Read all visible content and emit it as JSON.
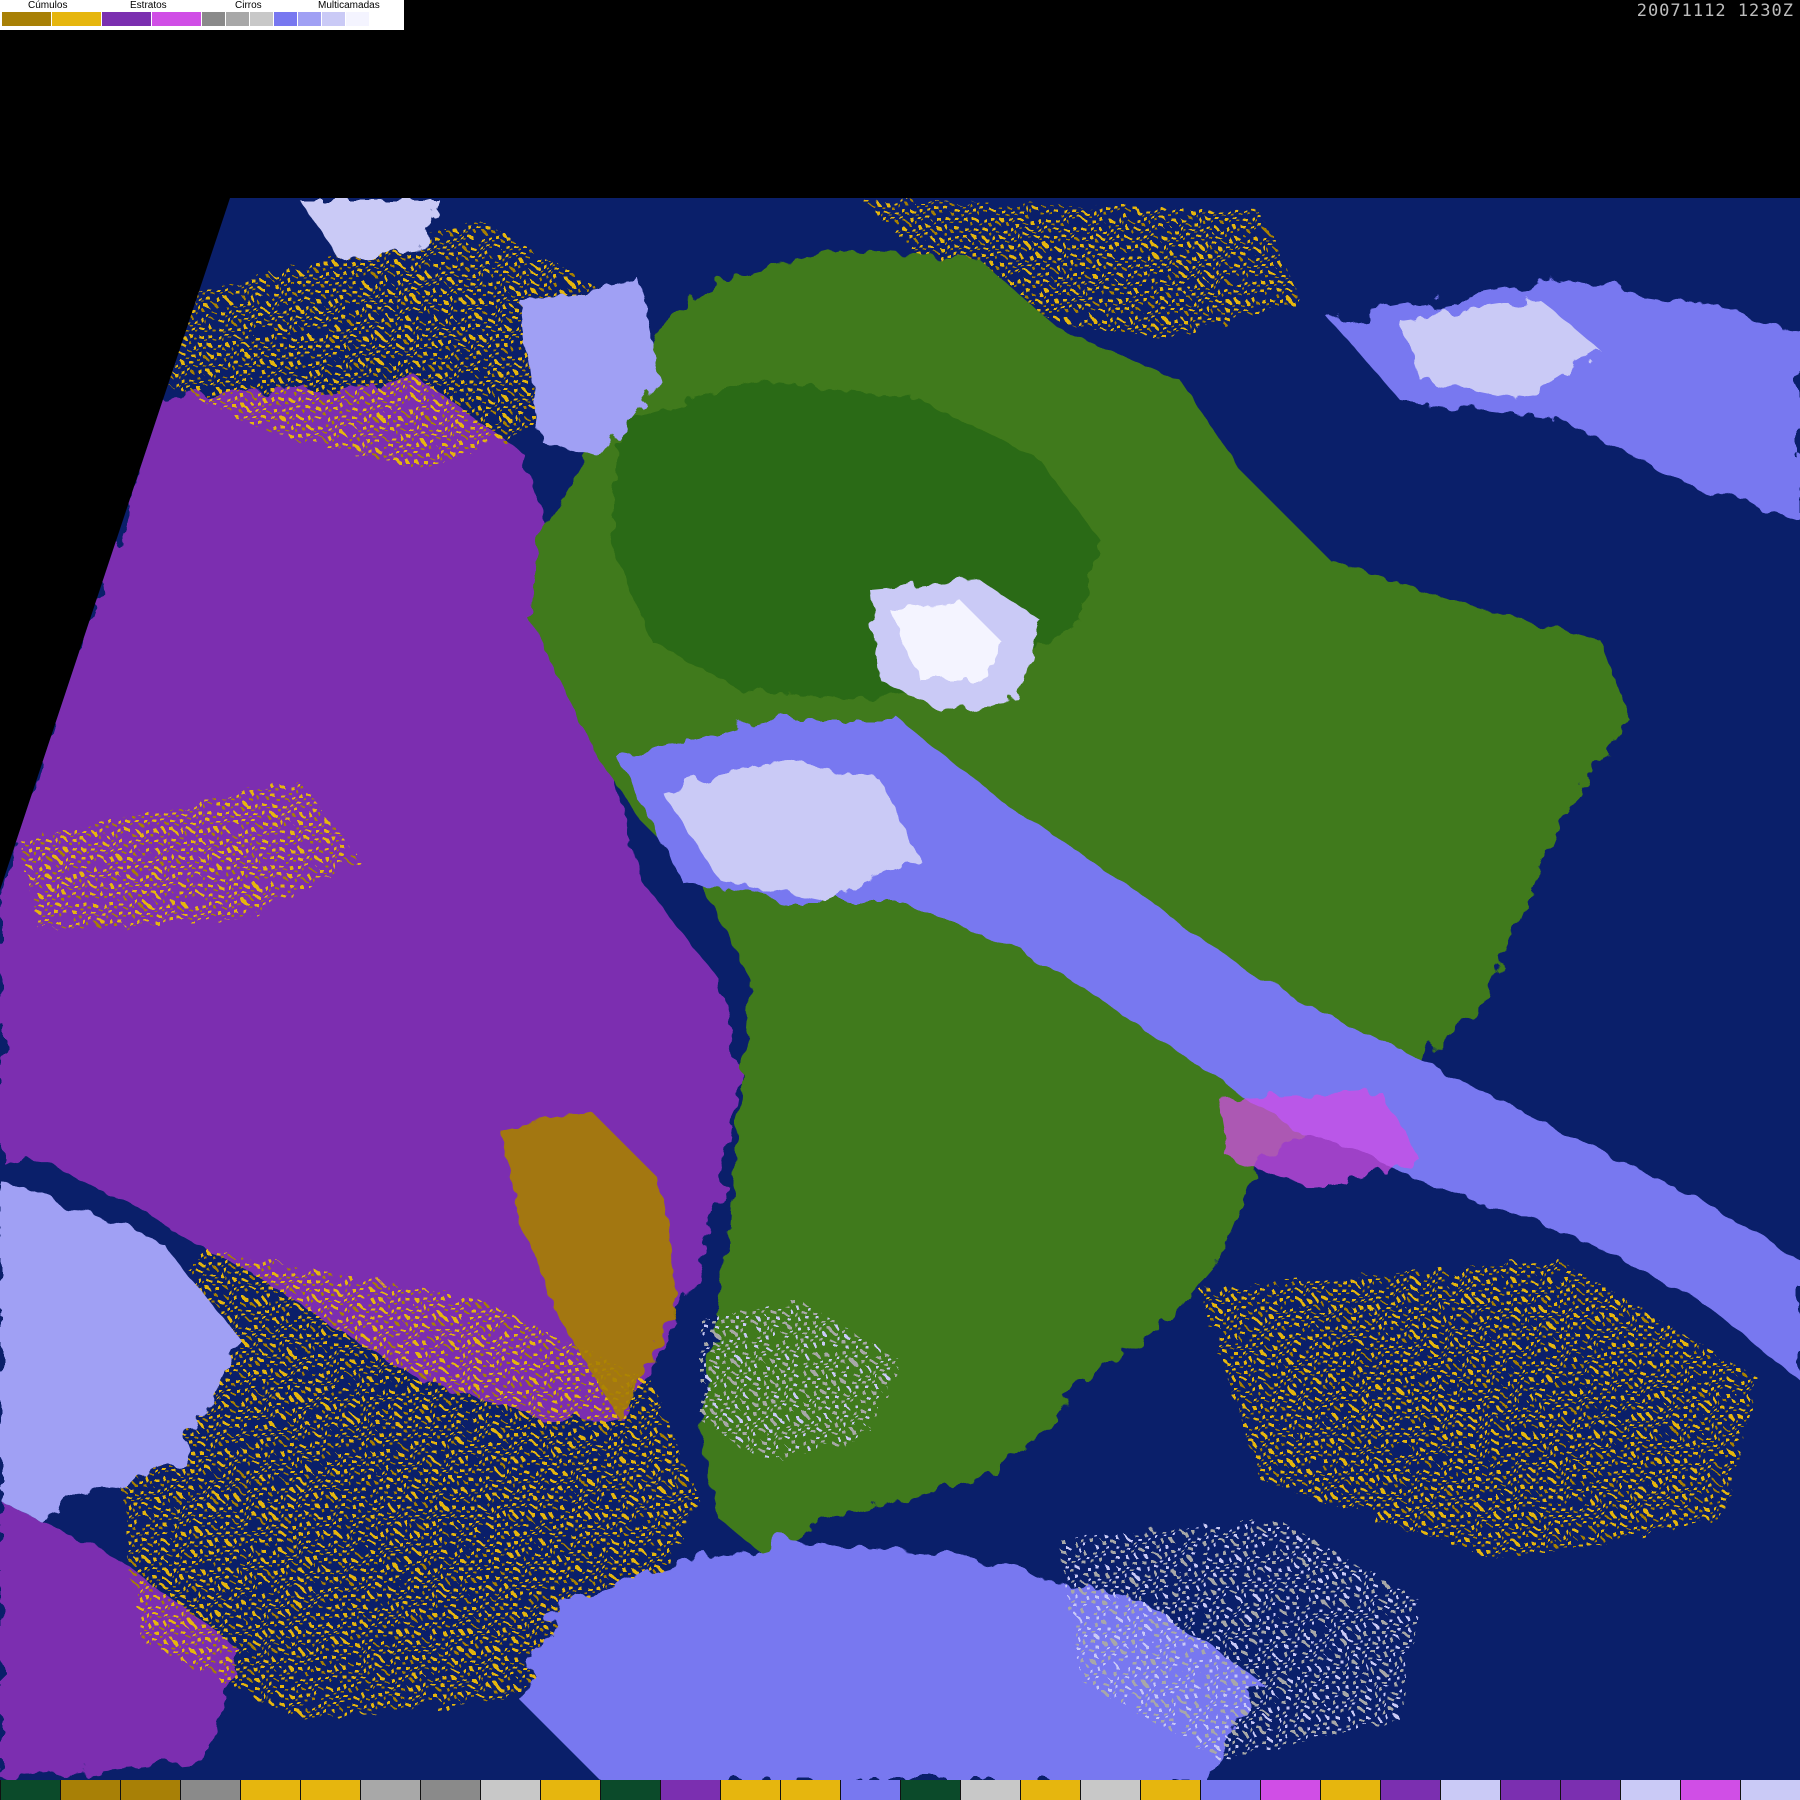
{
  "legend": {
    "groups": [
      {
        "label": "Cúmulos",
        "colors": [
          "#a88006",
          "#e6b60e"
        ]
      },
      {
        "label": "Estratos",
        "colors": [
          "#7b2fb0",
          "#d04ee6"
        ]
      },
      {
        "label": "Cirros",
        "colors": [
          "#8a8a8a",
          "#a8a8a8",
          "#c8c8c8"
        ]
      },
      {
        "label": "Multicamadas",
        "colors": [
          "#7878f0",
          "#a0a0f4",
          "#cacaf6",
          "#f4f4ff"
        ]
      }
    ]
  },
  "timestamp": "20071112 1230Z",
  "colors": {
    "background": "#000000",
    "ocean": "#0a1f6a",
    "land": "#3f7a1e",
    "forest": "#2a6a14",
    "cumulus_dark": "#a88006",
    "cumulus_light": "#e6b60e",
    "stratus": "#7b2fb0",
    "stratus_light": "#d04ee6",
    "cirrus": "#a8a8a8",
    "multilayer": "#7878f0",
    "multilayer_light": "#cacaf6"
  },
  "bottom_strip": [
    "#0b4a2a",
    "#a88006",
    "#a88006",
    "#8a8a8a",
    "#e6b60e",
    "#e6b60e",
    "#a8a8a8",
    "#8a8a8a",
    "#c8c8c8",
    "#e6b60e",
    "#0b4a2a",
    "#7b2fb0",
    "#e6b60e",
    "#e6b60e",
    "#7878f0",
    "#0b4a2a",
    "#c8c8c8",
    "#e6b60e",
    "#c8c8c8",
    "#e6b60e",
    "#7878f0",
    "#d04ee6",
    "#e6b60e",
    "#7b2fb0",
    "#cacaf6",
    "#7b2fb0",
    "#7b2fb0",
    "#cacaf6",
    "#d04ee6",
    "#cacaf6"
  ]
}
